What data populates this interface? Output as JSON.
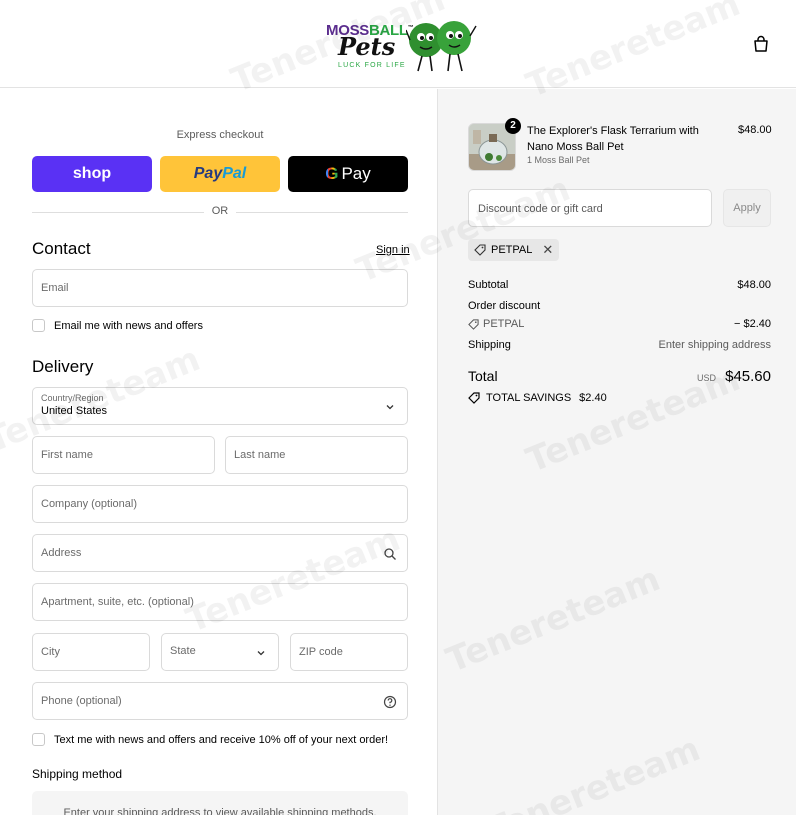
{
  "header": {
    "logo": {
      "word1a": "MOSS",
      "word1b": "BALL",
      "tm": "™",
      "word2": "Pets",
      "tagline": "LUCK FOR LIFE"
    },
    "cart_icon": "shopping-bag-icon"
  },
  "express": {
    "title": "Express checkout",
    "shop_label": "shop",
    "paypal_a": "Pay",
    "paypal_b": "Pal",
    "gpay_g": "G",
    "gpay_label": "Pay",
    "or_label": "OR"
  },
  "contact": {
    "title": "Contact",
    "sign_in": "Sign in",
    "email_placeholder": "Email",
    "news_label": "Email me with news and offers"
  },
  "delivery": {
    "title": "Delivery",
    "country_label": "Country/Region",
    "country_value": "United States",
    "first_name": "First name",
    "last_name": "Last name",
    "company": "Company (optional)",
    "address": "Address",
    "apartment": "Apartment, suite, etc. (optional)",
    "city": "City",
    "state": "State",
    "zip": "ZIP code",
    "phone": "Phone (optional)",
    "text_offer": "Text me with news and offers and receive 10% off of your next order!"
  },
  "shipping_method": {
    "title": "Shipping method",
    "message": "Enter your shipping address to view available shipping methods."
  },
  "summary": {
    "product": {
      "title": "The Explorer's Flask Terrarium with Nano Moss Ball Pet",
      "variant": "1 Moss Ball Pet",
      "price": "$48.00",
      "quantity": "2"
    },
    "discount_placeholder": "Discount code or gift card",
    "apply_label": "Apply",
    "code": "PETPAL",
    "subtotal_label": "Subtotal",
    "subtotal_value": "$48.00",
    "order_discount_label": "Order discount",
    "order_discount_code": "PETPAL",
    "order_discount_value": "− $2.40",
    "shipping_label": "Shipping",
    "shipping_value": "Enter shipping address",
    "total_label": "Total",
    "currency": "USD",
    "total_value": "$45.60",
    "savings_label": "TOTAL SAVINGS",
    "savings_value": "$2.40"
  },
  "watermark": "Tenereteam",
  "colors": {
    "shop": "#5a31f4",
    "paypal": "#ffc439",
    "gpay": "#000000",
    "summary_bg": "#f5f5f5"
  }
}
